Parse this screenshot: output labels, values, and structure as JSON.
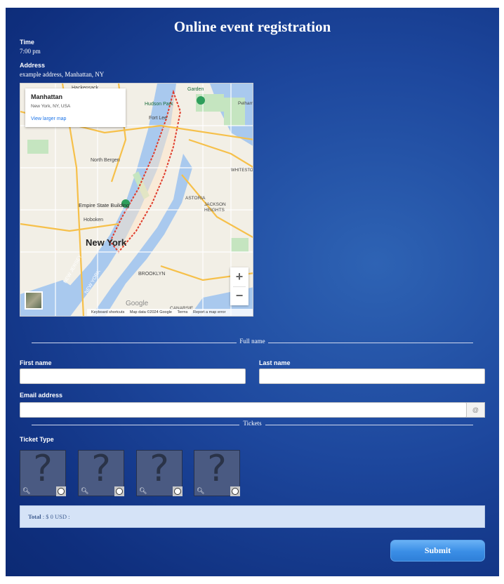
{
  "form": {
    "title": "Online event registration",
    "time_label": "Time",
    "time_value": "7:00 pm",
    "address_label": "Address",
    "address_value": "example address, Manhattan, NY"
  },
  "map": {
    "place_name": "Manhattan",
    "place_sub": "New York, NY, USA",
    "larger_map_link": "View larger map",
    "zoom_in": "+",
    "zoom_out": "−",
    "brand": "Google",
    "attribution": {
      "shortcuts": "Keyboard shortcuts",
      "data": "Map data ©2024 Google",
      "terms": "Terms",
      "report": "Report a map error"
    },
    "labels": [
      "Hackensack",
      "Hudson Park",
      "Fort Lee",
      "North Bergen",
      "Empire State Building",
      "Hoboken",
      "New York",
      "ASTORIA",
      "JACKSON HEIGHTS",
      "BROOKLYN",
      "CANARSIE",
      "NEW JERSEY",
      "NEW YORK",
      "Pelham Bay Park",
      "WHITESTONE",
      "Garden"
    ],
    "colors": {
      "water": "#a9c9ee",
      "land": "#f2efe6",
      "park": "#c5e5c0",
      "highway": "#f6c04a"
    }
  },
  "name_section": {
    "legend": "Full name",
    "first_label": "First name",
    "first_value": "",
    "last_label": "Last name",
    "last_value": ""
  },
  "email": {
    "label": "Email address",
    "value": "",
    "addon": "@"
  },
  "tickets": {
    "legend": "Tickets",
    "type_label": "Ticket Type",
    "options": [
      {
        "icon": "image-placeholder-icon"
      },
      {
        "icon": "image-placeholder-icon"
      },
      {
        "icon": "image-placeholder-icon"
      },
      {
        "icon": "image-placeholder-icon"
      }
    ]
  },
  "total": {
    "label": "Total",
    "text": " : $ 0 USD :"
  },
  "submit_label": "Submit",
  "colors": {
    "panel": "#1d479d",
    "submit": "#3a8ee6",
    "total_bg": "#d5e3f7"
  }
}
